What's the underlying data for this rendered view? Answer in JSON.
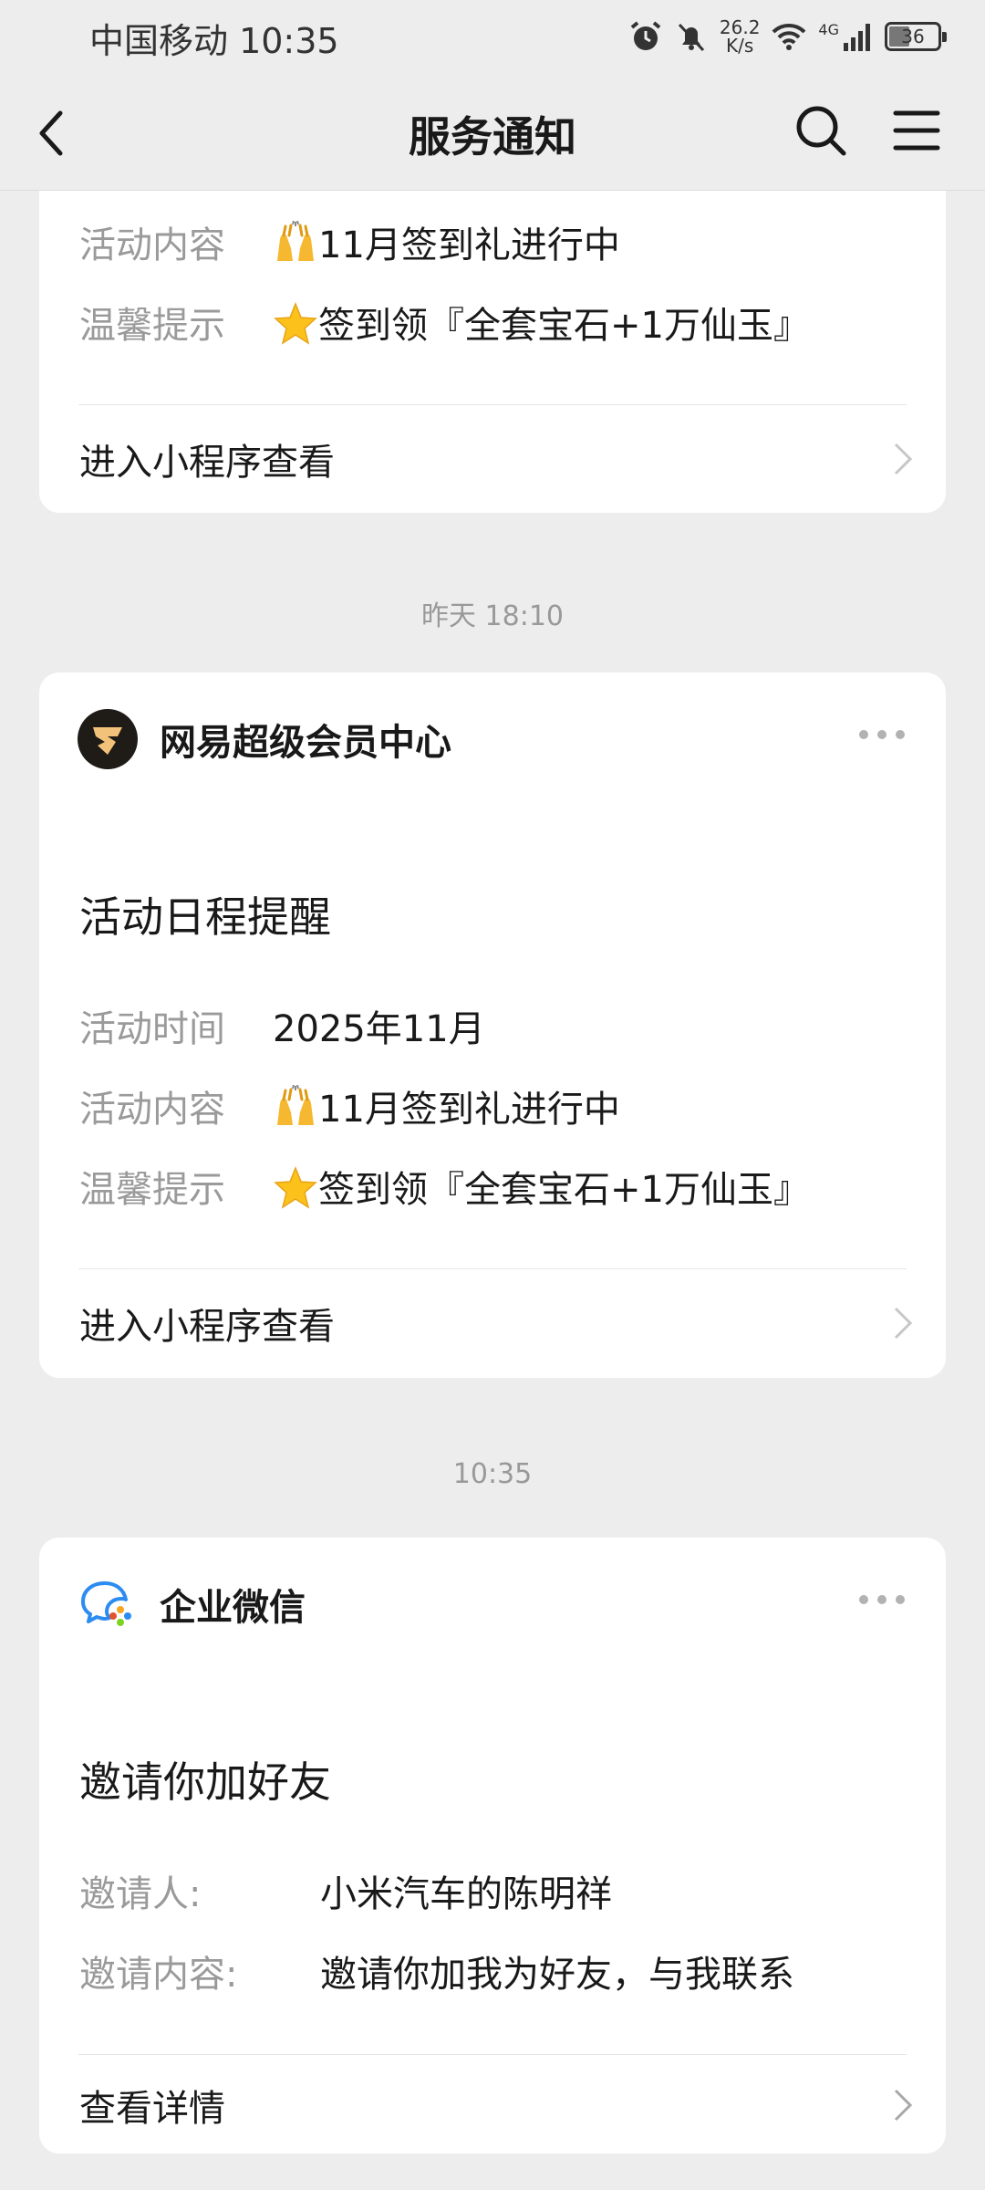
{
  "status_bar": {
    "carrier_time": "中国移动 10:35",
    "speed_top": "26.2",
    "speed_bottom": "K/s",
    "network": "4G",
    "battery": "36"
  },
  "nav": {
    "title": "服务通知"
  },
  "card1": {
    "rows": [
      {
        "key": "活动内容",
        "value": "11月签到礼进行中",
        "emoji": "raised-hands"
      },
      {
        "key": "温馨提示",
        "value": "签到领『全套宝石+1万仙玉』",
        "emoji": "star"
      }
    ],
    "action": "进入小程序查看"
  },
  "time1": "昨天 18:10",
  "card2": {
    "sender": "网易超级会员中心",
    "title": "活动日程提醒",
    "rows": [
      {
        "key": "活动时间",
        "value": "2025年11月"
      },
      {
        "key": "活动内容",
        "value": "11月签到礼进行中",
        "emoji": "raised-hands"
      },
      {
        "key": "温馨提示",
        "value": "签到领『全套宝石+1万仙玉』",
        "emoji": "star"
      }
    ],
    "action": "进入小程序查看"
  },
  "time2": "10:35",
  "card3": {
    "sender": "企业微信",
    "title": "邀请你加好友",
    "rows": [
      {
        "key": "邀请人:",
        "value": "小米汽车的陈明祥"
      },
      {
        "key": "邀请内容:",
        "value": "邀请你加我为好友，与我联系"
      }
    ],
    "action": "查看详情"
  },
  "colors": {
    "background": "#ededed",
    "card": "#ffffff",
    "label_gray": "#9a9a9a",
    "text": "#191919"
  }
}
